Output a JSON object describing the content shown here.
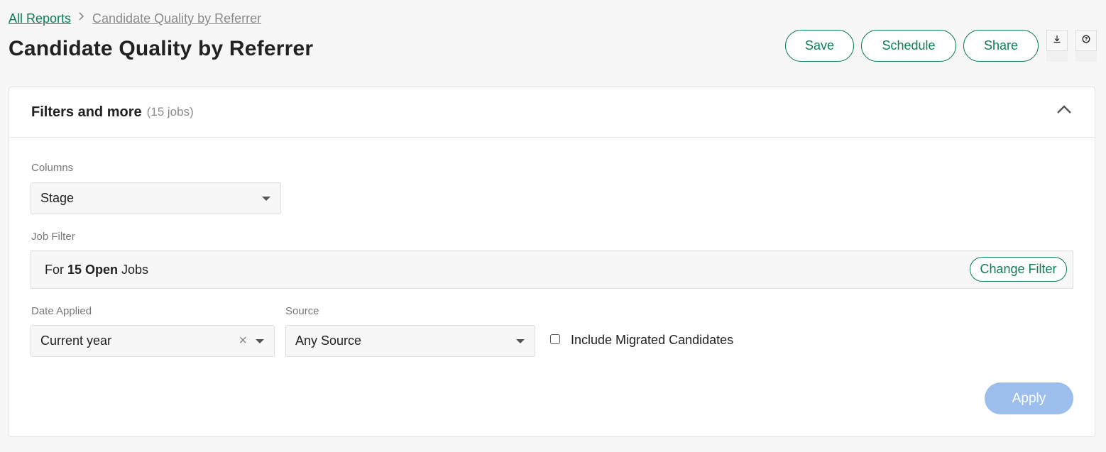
{
  "breadcrumb": {
    "root_label": "All Reports",
    "separator": "›",
    "current_label": "Candidate Quality by Referrer"
  },
  "page": {
    "title": "Candidate Quality by Referrer"
  },
  "toolbar": {
    "save_label": "Save",
    "schedule_label": "Schedule",
    "share_label": "Share",
    "download_icon": "download-icon",
    "help_icon": "help-icon"
  },
  "filters_panel": {
    "title": "Filters and more",
    "count": "(15 jobs)",
    "expanded": true,
    "columns": {
      "label": "Columns",
      "value": "Stage"
    },
    "job_filter": {
      "label": "Job Filter",
      "prefix": "For",
      "emphasis": "15 Open",
      "suffix": "Jobs",
      "change_label": "Change Filter"
    },
    "date_applied": {
      "label": "Date Applied",
      "value": "Current year",
      "clear_glyph": "×"
    },
    "source": {
      "label": "Source",
      "value": "Any Source"
    },
    "include_migrated": {
      "label": "Include Migrated Candidates",
      "checked": false
    },
    "apply_label": "Apply"
  },
  "colors": {
    "accent": "#0a7d5a",
    "apply_disabled": "#9dbdec",
    "background": "#f7f7f7"
  }
}
